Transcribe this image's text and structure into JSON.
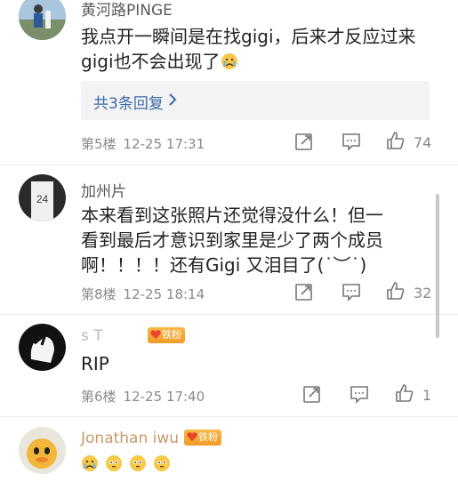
{
  "comments": [
    {
      "username": "黄河路PINGE",
      "text": "我点开一瞬间是在找gigi，后来才反应过来gigi也不会出现了",
      "trailing_emoji": "crying-face",
      "replies_label": "共3条回复",
      "floor": "第5楼",
      "time": "12-25 17:31",
      "likes": "74"
    },
    {
      "username": "加州片",
      "text": "本来看到这张照片还觉得没什么！但一看到最后才意识到家里是少了两个成员啊！！！！还有Gigi 又泪目了(˙︶˙)",
      "floor": "第8楼",
      "time": "12-25 18:14",
      "likes": "32"
    },
    {
      "username": "s      T",
      "badge": "铁粉",
      "text": "RIP",
      "floor": "第6楼",
      "time": "12-25 17:40",
      "likes": "1"
    },
    {
      "username": "Jonathan iwu",
      "badge": "铁粉",
      "emojis": [
        "crying-face",
        "pleading-face",
        "pleading-face",
        "pleading-face"
      ]
    }
  ],
  "colors": {
    "link": "#3b6ba8",
    "meta": "#8a8a8a",
    "badge": "#f19b2a"
  }
}
